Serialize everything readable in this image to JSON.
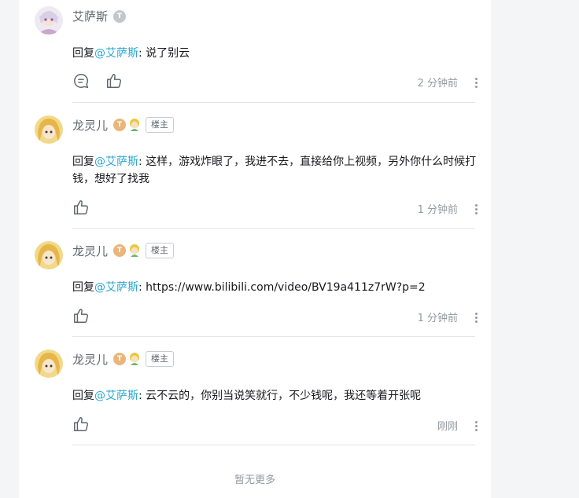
{
  "comments": [
    {
      "user": "艾萨斯",
      "reply_prefix": "回复",
      "mention": "@艾萨斯",
      "text": ": 说了别云",
      "time": "2 分钟前",
      "level_badge": "T",
      "has_reply_icon": true
    },
    {
      "user": "龙灵儿",
      "reply_prefix": "回复",
      "mention": "@艾萨斯",
      "text": ": 这样，游戏炸眼了，我进不去，直接给你上视频，另外你什么时候打钱，想好了找我",
      "time": "1 分钟前",
      "level_badge": "T",
      "owner_tag": "楼主"
    },
    {
      "user": "龙灵儿",
      "reply_prefix": "回复",
      "mention": "@艾萨斯",
      "text": ": https://www.bilibili.com/video/BV19a411z7rW?p=2",
      "time": "1 分钟前",
      "level_badge": "T",
      "owner_tag": "楼主"
    },
    {
      "user": "龙灵儿",
      "reply_prefix": "回复",
      "mention": "@艾萨斯",
      "text": ": 云不云的，你别当说笑就行，不少钱呢，我还等着开张呢",
      "time": "刚刚",
      "level_badge": "T",
      "owner_tag": "楼主"
    }
  ],
  "footer": "暂无更多",
  "icons": {
    "reply": "reply-bubble-icon",
    "like": "thumbs-up-icon",
    "more": "more-vertical-icon"
  },
  "colors": {
    "mention": "#2aa8d1",
    "muted": "#9499a0",
    "level_gold": "#e9b57a"
  }
}
